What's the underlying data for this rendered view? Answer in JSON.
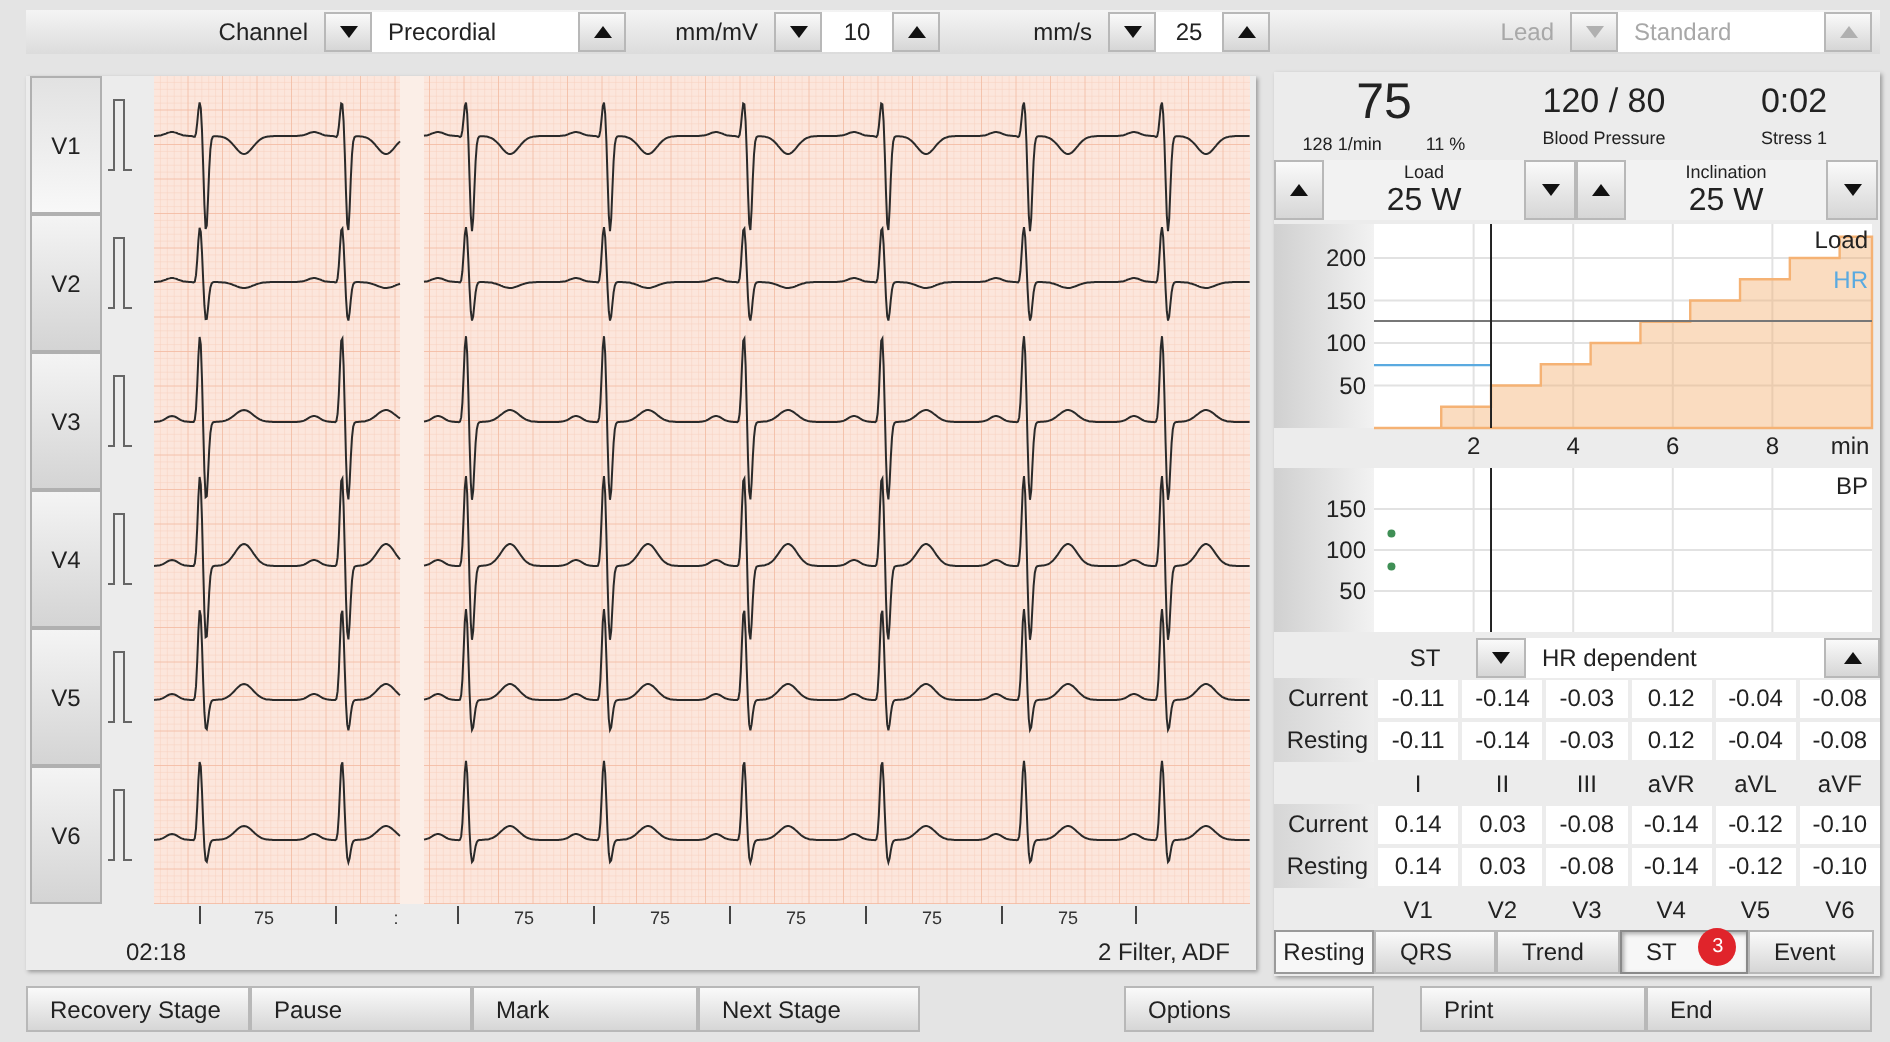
{
  "toolbar": {
    "spinners": [
      {
        "label": "Channel",
        "value": "Precordial",
        "disabled": false
      },
      {
        "label": "mm/mV",
        "value": "10",
        "disabled": false
      },
      {
        "label": "mm/s",
        "value": "25",
        "disabled": false
      },
      {
        "label": "Lead",
        "value": "Standard",
        "disabled": true
      }
    ]
  },
  "leads": [
    {
      "label": "V1",
      "selected": true
    },
    {
      "label": "V2",
      "selected": false
    },
    {
      "label": "V3",
      "selected": false
    },
    {
      "label": "V4",
      "selected": false
    },
    {
      "label": "V5",
      "selected": false
    },
    {
      "label": "V6",
      "selected": false
    }
  ],
  "ecg": {
    "axis_labels": [
      "75",
      ":",
      "75",
      "75",
      "75",
      "75",
      "75"
    ],
    "time": "02:18",
    "filter": "2 Filter, ADF"
  },
  "vitals": {
    "heart_rate": "75",
    "rate": "128 1/min",
    "percent": "11 %",
    "blood_pressure": "120 / 80",
    "blood_pressure_label": "Blood Pressure",
    "stage_time": "0:02",
    "stage": "Stress 1"
  },
  "settings": [
    {
      "label": "Load",
      "value": "25 W"
    },
    {
      "label": "Inclination",
      "value": "25 W"
    }
  ],
  "load_chart": {
    "chart_data": {
      "type": "area",
      "xlabel": "min",
      "x": [
        0,
        1.35,
        2.35,
        3.35,
        4.35,
        5.35,
        6.35,
        7.35,
        8.35,
        9.35,
        10
      ],
      "series": [
        {
          "name": "Load",
          "color": "#f5b274",
          "values": [
            0,
            25,
            50,
            75,
            100,
            125,
            150,
            175,
            200,
            225,
            225
          ]
        },
        {
          "name": "HR",
          "color": "#5aaae0",
          "type": "line",
          "values": [
            74,
            74,
            74,
            null,
            null,
            null,
            null,
            null,
            null,
            null,
            null
          ]
        }
      ],
      "xlim": [
        0,
        10
      ],
      "ylim": [
        0,
        240
      ],
      "xticks": [
        2,
        4,
        6,
        8
      ],
      "yticks": [
        50,
        100,
        150,
        200
      ],
      "grid": true,
      "ref_lines": [
        {
          "axis": "y",
          "value": 126
        },
        {
          "axis": "x",
          "value": 2.35
        }
      ]
    }
  },
  "bp_chart": {
    "chart_data": {
      "type": "scatter",
      "title": "BP",
      "x": [
        0.35
      ],
      "series": [
        {
          "color": "#3f8f55",
          "values": [
            120
          ]
        },
        {
          "color": "#3f8f55",
          "values": [
            80
          ]
        }
      ],
      "xlim": [
        0,
        10
      ],
      "ylim": [
        0,
        200
      ],
      "yticks": [
        50,
        100,
        150
      ],
      "grid": true,
      "ref_lines": [
        {
          "axis": "x",
          "value": 2.35
        }
      ]
    }
  },
  "st": {
    "label": "ST",
    "mode": "HR dependent",
    "tables": [
      {
        "rows": [
          {
            "label": "Current",
            "values": [
              "-0.11",
              "-0.14",
              "-0.03",
              "0.12",
              "-0.04",
              "-0.08"
            ]
          },
          {
            "label": "Resting",
            "values": [
              "-0.11",
              "-0.14",
              "-0.03",
              "0.12",
              "-0.04",
              "-0.08"
            ]
          }
        ],
        "columns": [
          "I",
          "II",
          "III",
          "aVR",
          "aVL",
          "aVF"
        ]
      },
      {
        "rows": [
          {
            "label": "Current",
            "values": [
              "0.14",
              "0.03",
              "-0.08",
              "-0.14",
              "-0.12",
              "-0.10"
            ]
          },
          {
            "label": "Resting",
            "values": [
              "0.14",
              "0.03",
              "-0.08",
              "-0.14",
              "-0.12",
              "-0.10"
            ]
          }
        ],
        "columns": [
          "V1",
          "V2",
          "V3",
          "V4",
          "V5",
          "V6"
        ]
      }
    ]
  },
  "resting_toggle": {
    "label": "Resting",
    "on": true
  },
  "tabs": [
    {
      "label": "QRS",
      "selected": false
    },
    {
      "label": "Trend",
      "selected": false
    },
    {
      "label": "ST",
      "selected": true,
      "badge": "3"
    },
    {
      "label": "Event",
      "selected": false
    }
  ],
  "bottom_bar": {
    "left": [
      "Recovery Stage",
      "Pause",
      "Mark",
      "Next Stage"
    ],
    "center": [
      "Options"
    ],
    "right": [
      "Print",
      "End"
    ]
  }
}
